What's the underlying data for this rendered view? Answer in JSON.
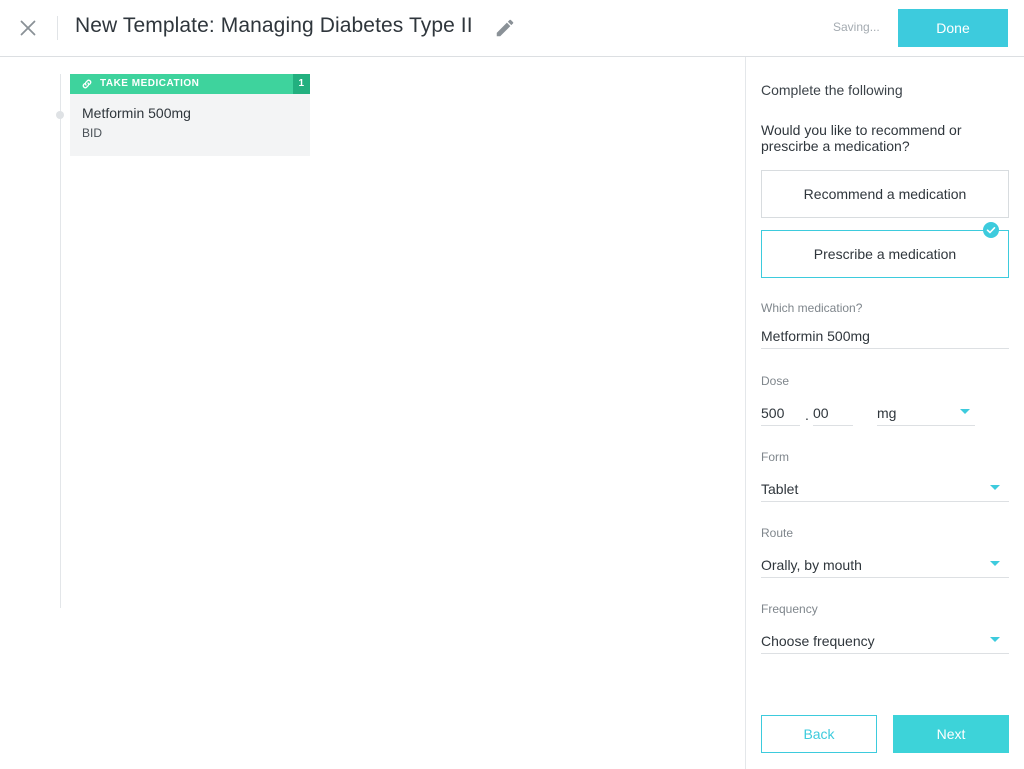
{
  "header": {
    "title": "New Template: Managing Diabetes Type II",
    "status": "Saving...",
    "done_label": "Done"
  },
  "colors": {
    "accent": "#3dcbdd",
    "step_green": "#3ed39d",
    "step_count_green": "#22b07f"
  },
  "canvas": {
    "steps": [
      {
        "type_label": "TAKE MEDICATION",
        "count": "1",
        "name": "Metformin 500mg",
        "frequency": "BID",
        "icon": "link-icon"
      }
    ]
  },
  "panel": {
    "heading": "Complete the following",
    "question": "Would you like to recommend or prescirbe a medication?",
    "choices": [
      {
        "label": "Recommend a medication",
        "selected": false
      },
      {
        "label": "Prescribe a medication",
        "selected": true
      }
    ],
    "medication": {
      "label": "Which medication?",
      "value": "Metformin 500mg"
    },
    "dose": {
      "label": "Dose",
      "whole": "500",
      "separator": ".",
      "decimal": "00",
      "unit": "mg"
    },
    "form": {
      "label": "Form",
      "value": "Tablet"
    },
    "route": {
      "label": "Route",
      "value": "Orally, by mouth"
    },
    "frequency": {
      "label": "Frequency",
      "value": "Choose frequency"
    },
    "back_label": "Back",
    "next_label": "Next"
  }
}
